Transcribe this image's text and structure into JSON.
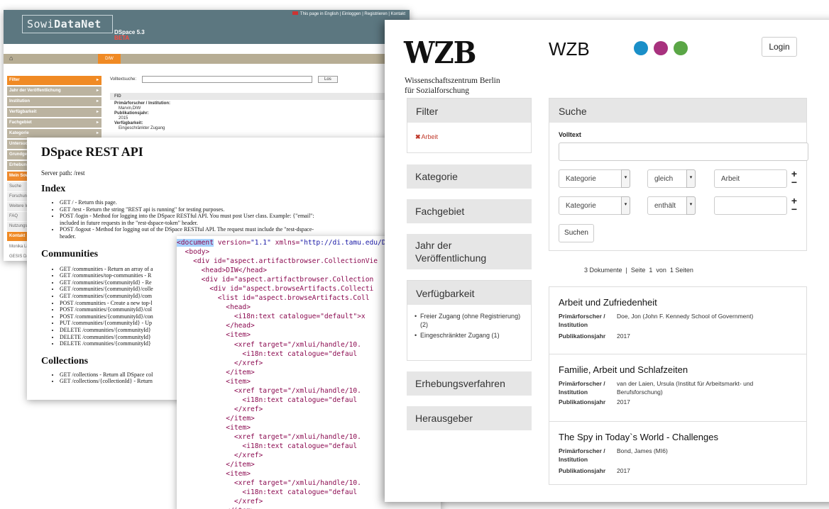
{
  "sowi": {
    "logo_prefix": "Sowi",
    "logo_bold": "DataNet",
    "version": "DSpace 5.3",
    "beta": "BETA",
    "toplinks": "This page in English | Einloggen | Registrieren | Kontakt",
    "home_icon": "⌂",
    "crumb": "DIW",
    "sidebar": [
      "Filter",
      "Jahr der Veröffentlichung",
      "Institution",
      "Verfügbarkeit",
      "Fachgebiet",
      "Kategorie",
      "Untersuchungsgebiet",
      "Grundgesamtheit",
      "Erhebungsverfahren",
      "Mein SowiDataNet"
    ],
    "sidebar_sub": [
      "Suche",
      "Forschungsdaten",
      "Weitere Infos",
      "FAQ",
      "Nutzungsbedingungen"
    ],
    "kontakt": "Kontakt",
    "kontakt_lines": [
      "Monika Linne",
      "GESIS Datenarchiv"
    ],
    "volltextsuche_label": "Volltextsuche:",
    "los_button": "Los",
    "fid": "FID",
    "meta": [
      {
        "k": "Primärforscher / Institution:",
        "v": "Marvin,DIW"
      },
      {
        "k": "Publikationsjahr:",
        "v": "2015"
      },
      {
        "k": "Verfügbarkeit:",
        "v": "Eingeschränkter Zugang"
      }
    ]
  },
  "rest": {
    "title": "DSpace REST API",
    "server_path": "Server path: /rest",
    "index_heading": "Index",
    "index_items": [
      "GET / - Return this page.",
      "GET /test - Return the string \"REST api is running\" for testing purposes.",
      "POST /login - Method for logging into the DSpace RESTful API. You must post User class. Example: {\"email\":",
      "included in future requests in the \"rest-dspace-token\" header.",
      "POST /logout - Method for logging out of the DSpace RESTful API. The request must include the \"rest-dspace-",
      "header."
    ],
    "communities_heading": "Communities",
    "communities_items": [
      "GET /communities - Return an array of a",
      "GET /communities/top-communities - R",
      "GET /communities/{communityId} - Re",
      "GET /communities/{communityId}/colle",
      "GET /communities/{communityId}/com",
      "POST /communities - Create a new top-l",
      "POST /communities/{communityId}/col",
      "POST /communities/{communityId}/con",
      "PUT /communities/{communityId} - Up",
      "DELETE /communities/{communityId}",
      "DELETE /communities/{communityId}",
      "DELETE /communities/{communityId}"
    ],
    "collections_heading": "Collections",
    "collections_items": [
      "GET /collections - Return all DSpace col",
      "GET /collections/{collectionId} - Return"
    ]
  },
  "xml": {
    "doc_tag": "<document",
    "doc_attr": " version=",
    "doc_val": "\"1.1\"",
    "doc_attr2": " xmlns=",
    "doc_val2": "\"http://di.tamu.edu/D",
    "lines": [
      "  <body>",
      "    <div id=\"aspect.artifactbrowser.CollectionVie",
      "      <head>DIW</head>",
      "      <div id=\"aspect.artifactbrowser.Collection",
      "        <div id=\"aspect.browseArtifacts.Collecti",
      "          <list id=\"aspect.browseArtifacts.Coll",
      "            <head>",
      "              <i18n:text catalogue=\"default\">x",
      "            </head>",
      "            <item>",
      "              <xref target=\"/xmlui/handle/10.",
      "                <i18n:text catalogue=\"defaul",
      "              </xref>",
      "            </item>",
      "            <item>",
      "              <xref target=\"/xmlui/handle/10.",
      "                <i18n:text catalogue=\"defaul",
      "              </xref>",
      "            </item>",
      "            <item>",
      "              <xref target=\"/xmlui/handle/10.",
      "                <i18n:text catalogue=\"defaul",
      "              </xref>",
      "            </item>",
      "            <item>",
      "              <xref target=\"/xmlui/handle/10.",
      "                <i18n:text catalogue=\"defaul",
      "              </xref>",
      "            </item>",
      "          </list>"
    ]
  },
  "wzb": {
    "logo": "WZB",
    "logo_sub1": "Wissenschaftszentrum Berlin",
    "logo_sub2": "für Sozialforschung",
    "brand": "WZB",
    "dot_colors": [
      "#1a8fc8",
      "#a8317e",
      "#5aa646"
    ],
    "login": "Login",
    "filter_heading": "Filter",
    "active_filter": "Arbeit",
    "facets": [
      "Kategorie",
      "Fachgebiet",
      "Jahr der Veröffentlichung",
      "Verfügbarkeit",
      "Erhebungsverfahren",
      "Herausgeber"
    ],
    "availability_options": [
      "Freier Zugang (ohne Registrierung) (2)",
      "Eingeschränkter Zugang (1)"
    ],
    "search": {
      "heading": "Suche",
      "volltext_label": "Volltext",
      "volltext_value": "",
      "row1": {
        "field": "Kategorie",
        "op": "gleich",
        "value": "Arbeit"
      },
      "row2": {
        "field": "Kategorie",
        "op": "enthält",
        "value": ""
      },
      "plus": "+",
      "minus": "−",
      "submit": "Suchen"
    },
    "count_text": "3 Dokumente  |  Seite  1  von  1 Seiten",
    "results": [
      {
        "title": "Arbeit und Zufriedenheit",
        "k1": "Primärforscher / Institution",
        "v1": "Doe, Jon (John F. Kennedy School of Government)",
        "k2": "Publikationsjahr",
        "v2": "2017"
      },
      {
        "title": "Familie, Arbeit und Schlafzeiten",
        "k1": "Primärforscher / Institution",
        "v1": "van der Laien, Ursula (Institut für Arbeitsmarkt- und Berufsforschung)",
        "k2": "Publikationsjahr",
        "v2": "2017"
      },
      {
        "title": "The Spy in Today`s World - Challenges",
        "k1": "Primärforscher / Institution",
        "v1": "Bond, James (MI6)",
        "k2": "Publikationsjahr",
        "v2": "2017"
      }
    ]
  }
}
